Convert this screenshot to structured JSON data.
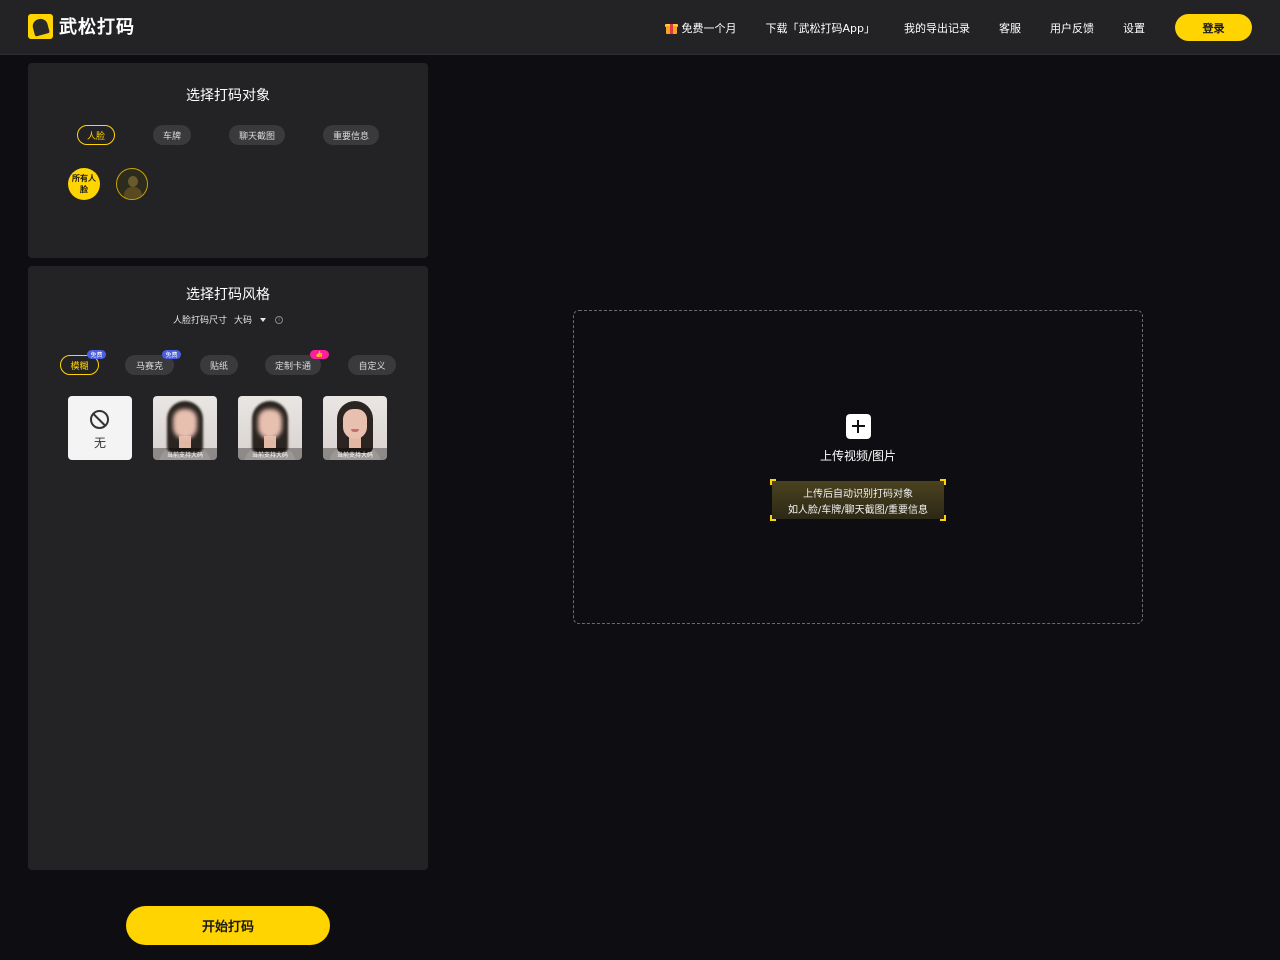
{
  "header": {
    "logo_text": "武松打码",
    "logo_icon": "martial-artist-logo-icon",
    "nav": {
      "free_month": "免费一个月",
      "download": "下载「武松打码App」",
      "export_history": "我的导出记录",
      "customer_service": "客服",
      "feedback": "用户反馈",
      "settings": "设置",
      "login": "登录"
    }
  },
  "target_panel": {
    "title": "选择打码对象",
    "tabs": [
      {
        "label": "人脸",
        "active": true
      },
      {
        "label": "车牌",
        "active": false
      },
      {
        "label": "聊天截图",
        "active": false
      },
      {
        "label": "重要信息",
        "active": false
      }
    ],
    "all_faces_label": "所有人脸"
  },
  "style_panel": {
    "title": "选择打码风格",
    "size_label": "人脸打码尺寸",
    "size_value": "大码",
    "styles": [
      {
        "label": "模糊",
        "active": true,
        "badge": "免费"
      },
      {
        "label": "马赛克",
        "active": false,
        "badge": "免费"
      },
      {
        "label": "贴纸",
        "active": false,
        "badge": ""
      },
      {
        "label": "定制卡通",
        "active": false,
        "badge": "👍"
      },
      {
        "label": "自定义",
        "active": false,
        "badge": ""
      }
    ],
    "cards": {
      "none_label": "无",
      "caption": "当前支持大码"
    }
  },
  "start_button": "开始打码",
  "upload": {
    "label": "上传视频/图片",
    "hint_line1": "上传后自动识别打码对象",
    "hint_line2": "如人脸/车牌/聊天截图/重要信息"
  },
  "colors": {
    "accent": "#ffd400",
    "background": "#0e0e12",
    "panel": "#232325",
    "badge_blue": "#4a5ee0",
    "badge_pink": "#ff1f9a"
  }
}
